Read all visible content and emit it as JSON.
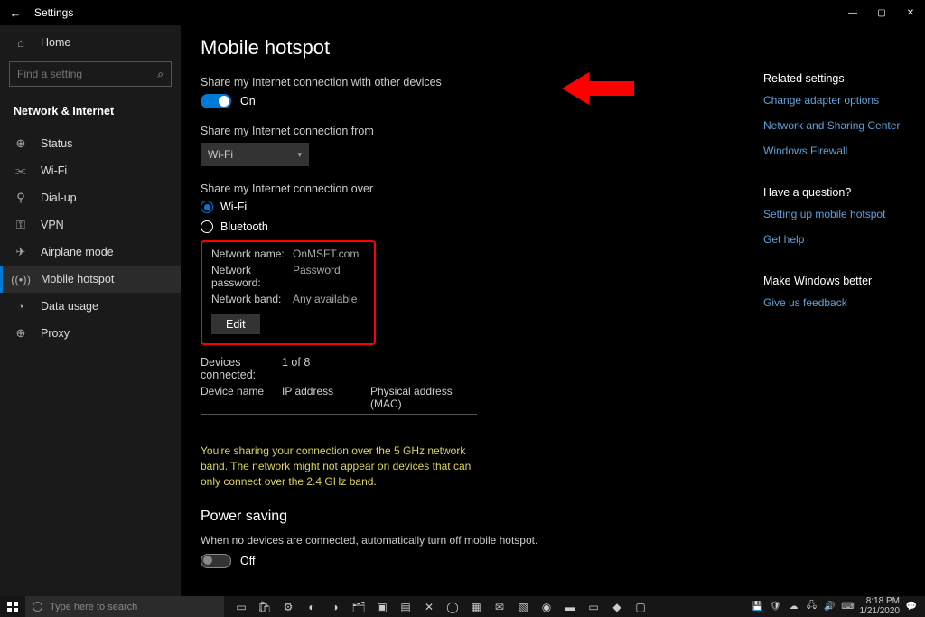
{
  "window": {
    "title": "Settings"
  },
  "sidebar": {
    "home": "Home",
    "search_placeholder": "Find a setting",
    "category": "Network & Internet",
    "items": [
      {
        "label": "Status",
        "icon": "⊕"
      },
      {
        "label": "Wi-Fi",
        "icon": "⫘"
      },
      {
        "label": "Dial-up",
        "icon": "⚲"
      },
      {
        "label": "VPN",
        "icon": "⚿"
      },
      {
        "label": "Airplane mode",
        "icon": "✈"
      },
      {
        "label": "Mobile hotspot",
        "icon": "((•))"
      },
      {
        "label": "Data usage",
        "icon": "◔"
      },
      {
        "label": "Proxy",
        "icon": "⊕"
      }
    ]
  },
  "page": {
    "title": "Mobile hotspot",
    "share_toggle_label": "Share my Internet connection with other devices",
    "share_toggle_state": "On",
    "share_from_label": "Share my Internet connection from",
    "share_from_value": "Wi-Fi",
    "share_over_label": "Share my Internet connection over",
    "radio_wifi": "Wi-Fi",
    "radio_bt": "Bluetooth",
    "network": {
      "name_label": "Network name:",
      "name_value": "OnMSFT.com",
      "pass_label": "Network password:",
      "pass_value": "Password",
      "band_label": "Network band:",
      "band_value": "Any available",
      "edit": "Edit"
    },
    "devices_connected_label": "Devices connected:",
    "devices_connected_value": "1 of 8",
    "col_device": "Device name",
    "col_ip": "IP address",
    "col_mac": "Physical address (MAC)",
    "warning": "You're sharing your connection over the 5 GHz network band. The network might not appear on devices that can only connect over the 2.4 GHz band.",
    "power_title": "Power saving",
    "power_desc": "When no devices are connected, automatically turn off mobile hotspot.",
    "power_state": "Off"
  },
  "right": {
    "related_head": "Related settings",
    "link_adapter": "Change adapter options",
    "link_sharing": "Network and Sharing Center",
    "link_firewall": "Windows Firewall",
    "question_head": "Have a question?",
    "link_setup": "Setting up mobile hotspot",
    "link_gethelp": "Get help",
    "better_head": "Make Windows better",
    "link_feedback": "Give us feedback"
  },
  "taskbar": {
    "search_placeholder": "Type here to search",
    "time": "8:18 PM",
    "date": "1/21/2020"
  }
}
